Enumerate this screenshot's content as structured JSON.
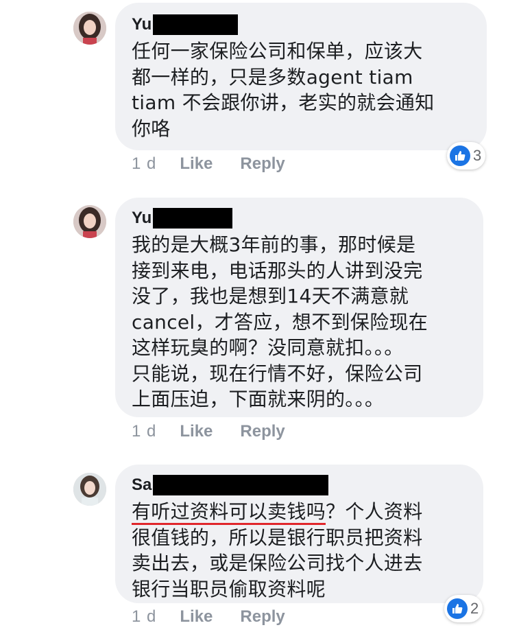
{
  "comments": [
    {
      "author": "Yu",
      "lines": [
        "任何一家保险公司和保单，应该大",
        "都一样的，只是多数agent tiam",
        "tiam 不会跟你讲，老实的就会通知",
        "你咯"
      ],
      "time": "1 d",
      "like_label": "Like",
      "reply_label": "Reply",
      "reaction_count": "3"
    },
    {
      "author": "Yu",
      "lines": [
        "我的是大概3年前的事，那时候是",
        "接到来电，电话那头的人讲到没完",
        "没了，我也是想到14天不满意就",
        "cancel，才答应，想不到保险现在",
        "这样玩臭的啊？没同意就扣。。。",
        "只能说，现在行情不好，保险公司",
        "上面压迫，下面就来阴的。。。"
      ],
      "time": "1 d",
      "like_label": "Like",
      "reply_label": "Reply"
    },
    {
      "author": "Sa",
      "underlined": "有听过资料可以卖钱吗",
      "line1_rest": "？个人资料",
      "lines": [
        "很值钱的，所以是银行职员把资料",
        "卖出去，或是保险公司找个人进去",
        "银行当职员偷取资料呢"
      ],
      "time": "1 d",
      "like_label": "Like",
      "reply_label": "Reply",
      "reaction_count": "2"
    }
  ],
  "colors": {
    "bubble": "#f0f1f4",
    "meta_text": "#8d949e",
    "like_blue": "#1b74e4",
    "underline_red": "#e0262b"
  },
  "icons": [
    "avatar",
    "like-thumb-icon"
  ]
}
